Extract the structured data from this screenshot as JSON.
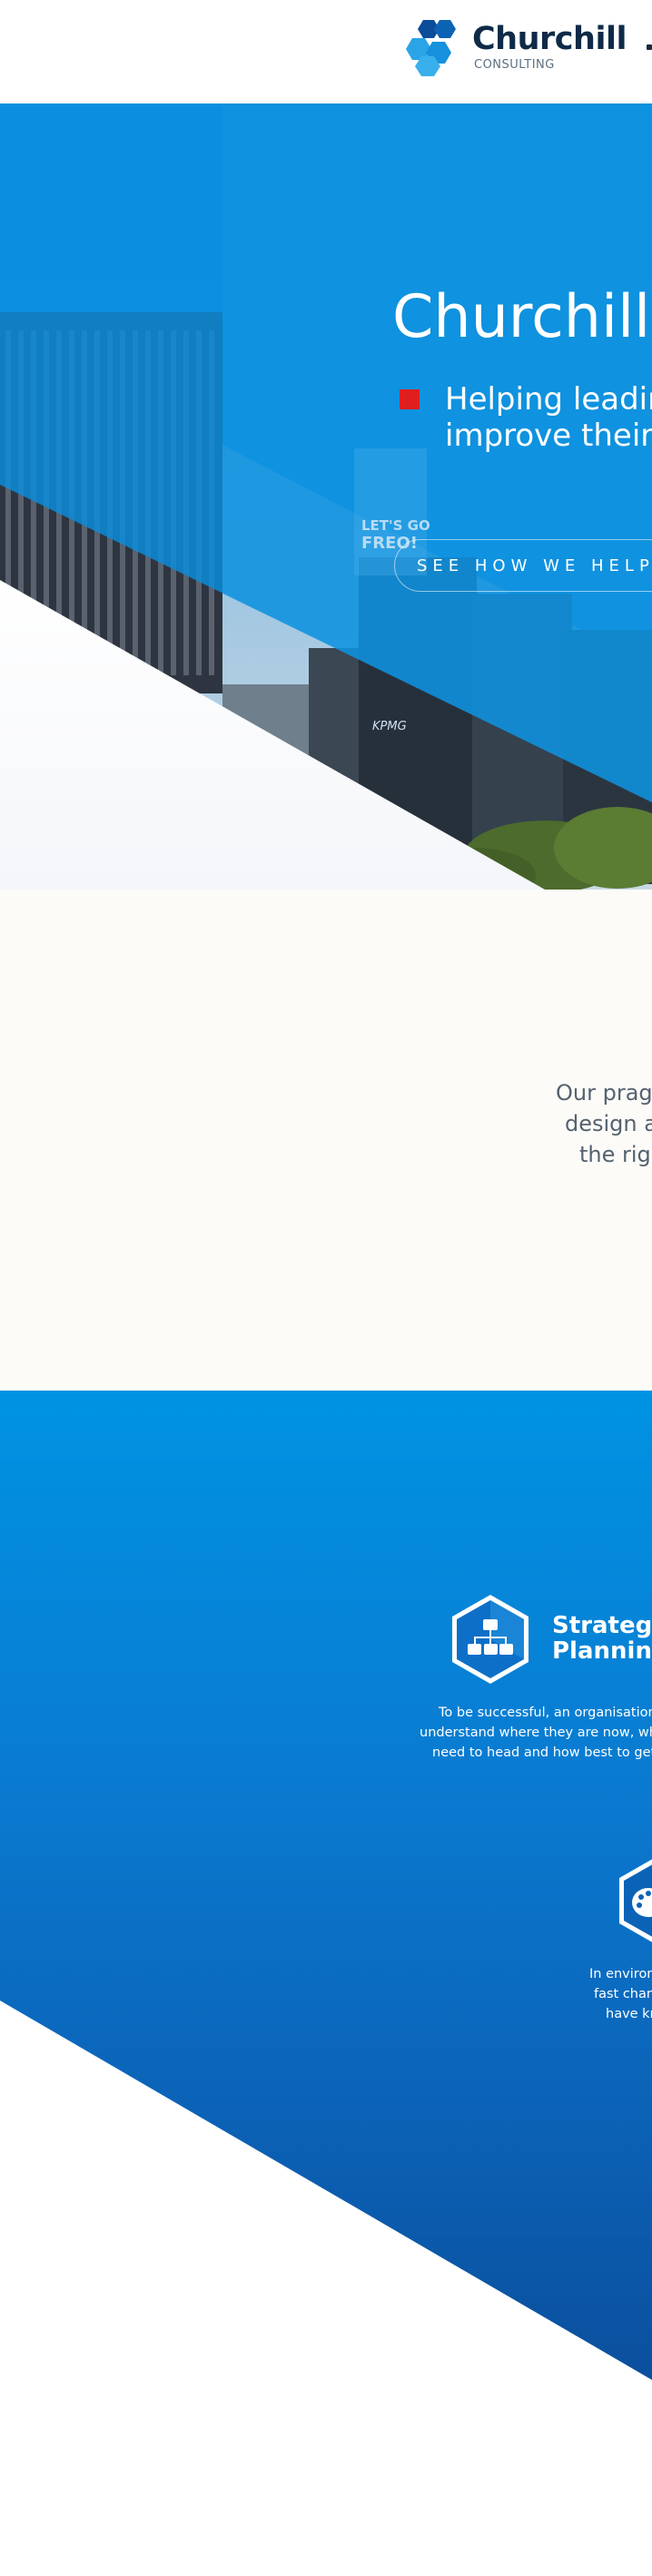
{
  "header": {
    "logo_name": "Churchill",
    "logo_sub": "CONSULTING"
  },
  "hero": {
    "title": "Churchill",
    "subtitle_line1": "Helping leadin",
    "subtitle_line2": "improve their",
    "cta_label": "SEE HOW WE HELP",
    "sign_text_1": "LET'S GO",
    "sign_text_2": "FREO!",
    "building_sign": "KPMG"
  },
  "intro": {
    "line1": "Our pragm",
    "line2": "design an",
    "line3": "the righ"
  },
  "services": {
    "items": [
      {
        "title_line1": "Strategy",
        "title_line2": "Planning",
        "icon": "org-chart-icon",
        "desc_line1": "To be successful, an organisation",
        "desc_line2": "understand where they are now, wh",
        "desc_line3": "need to head and how best to get"
      },
      {
        "icon": "palette-icon",
        "desc_line1": "In environ",
        "desc_line2": "fast chan",
        "desc_line3": "have kn"
      }
    ]
  },
  "colors": {
    "brand_navy": "#0f2a47",
    "brand_blue": "#0a8fde",
    "accent_red": "#e01e1e",
    "services_top": "#0093e3",
    "services_bottom": "#0b4c99"
  }
}
